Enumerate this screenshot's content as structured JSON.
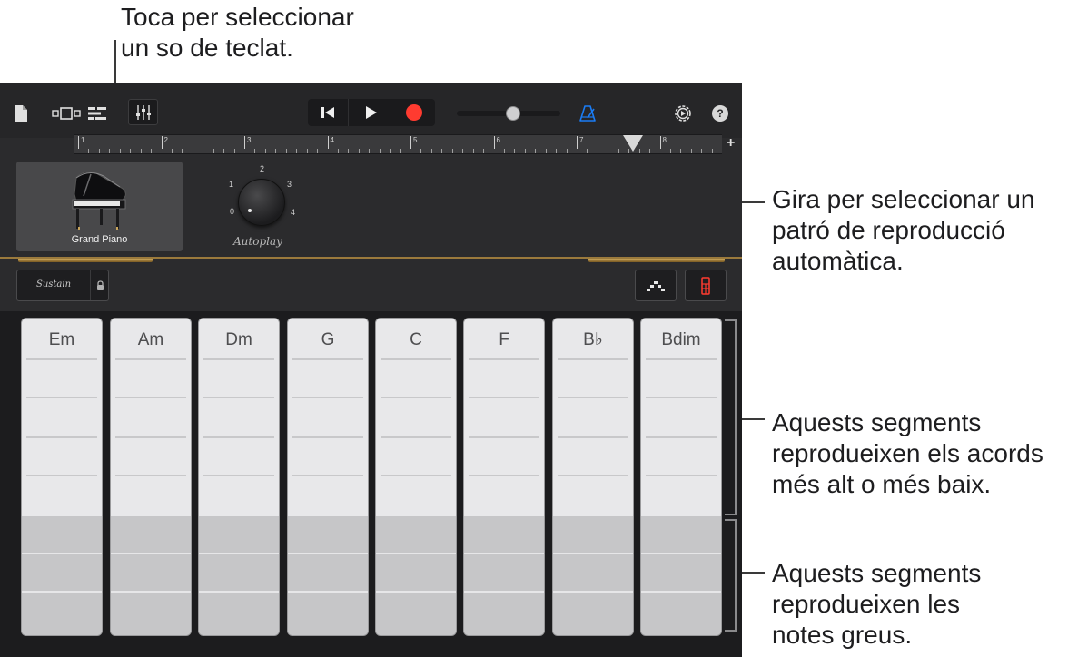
{
  "callouts": {
    "sound": "Toca per seleccionar\nun so de teclat.",
    "autoplay": "Gira per seleccionar un\npatró de reproducció\nautomàtica.",
    "chords": "Aquests segments\nreprodueixen els acords\nmés alt o més baix.",
    "bass": "Aquests segments\nreprodueixen les\nnotes greus."
  },
  "toolbar": {
    "icons": [
      "document-icon",
      "view-toggle-icon",
      "tracks-view-icon",
      "mixer-icon",
      "rewind-icon",
      "play-icon",
      "record-icon",
      "metronome-icon",
      "settings-icon",
      "help-icon"
    ],
    "help_label": "?",
    "master_volume": 0.55,
    "accent_color": "#1a7cf5",
    "record_color": "#ff3b30"
  },
  "ruler": {
    "bars": [
      "1",
      "2",
      "3",
      "4",
      "5",
      "6",
      "7",
      "8"
    ],
    "plus_label": "+"
  },
  "instrument": {
    "name": "Grand Piano",
    "icon": "grand-piano-icon"
  },
  "autoplay": {
    "label": "Autoplay",
    "positions": [
      "0",
      "1",
      "2",
      "3",
      "4"
    ],
    "selected": "0"
  },
  "controls": {
    "sustain_label": "Sustain",
    "lock_icon": "lock-icon",
    "arpeggiator_icon": "arpeggiator-icon",
    "keyboard_icon": "keyboard-toggle-icon",
    "keyboard_icon_color": "#ff3b30"
  },
  "chords": [
    "Em",
    "Am",
    "Dm",
    "G",
    "C",
    "F",
    "B♭",
    "Bdim"
  ]
}
